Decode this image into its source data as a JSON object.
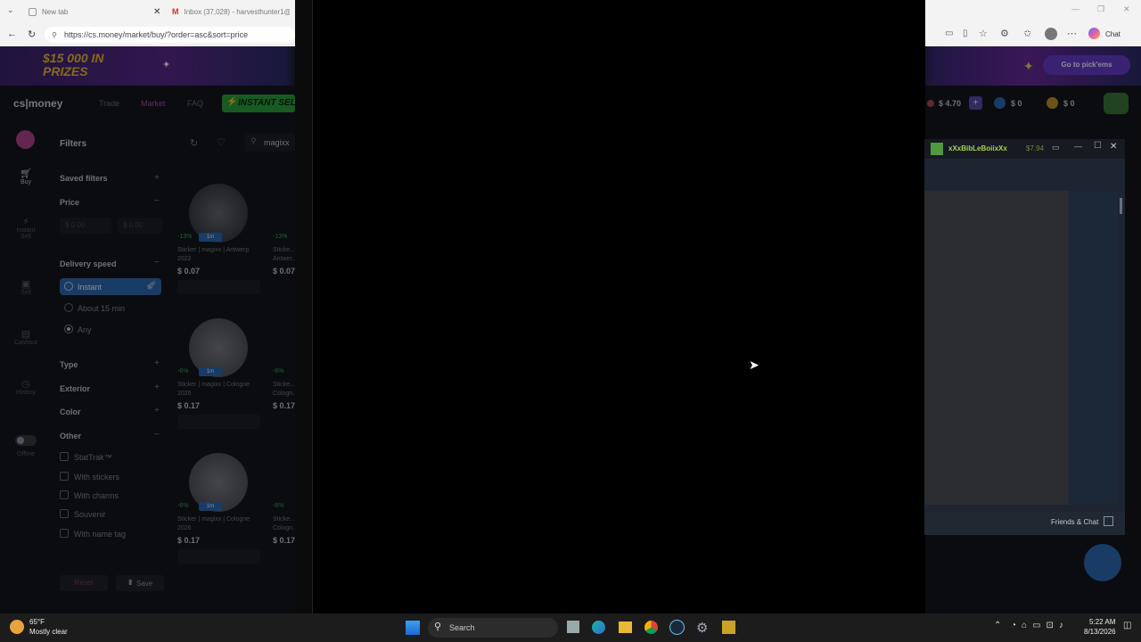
{
  "browser": {
    "tabs": [
      {
        "label": "New tab"
      },
      {
        "label": "Inbox (37,028) - harvesthunter1@..."
      }
    ],
    "url": "https://cs.money/market/buy/?order=asc&sort=price",
    "chat_label": "Chat"
  },
  "site": {
    "logo": "cs|money",
    "promo": "$15 000 IN PRIZES",
    "promo_cta": "Go to pick'ems",
    "nav": [
      "Trade",
      "Market",
      "FAQ"
    ],
    "instant_sell": "INSTANT SELL",
    "balances": [
      "$ 4.70",
      "$ 0",
      "$ 0"
    ]
  },
  "sidebar_nav": [
    {
      "label": "Buy"
    },
    {
      "label": "Instant Sell"
    },
    {
      "label": "Sell"
    },
    {
      "label": "Cashout"
    },
    {
      "label": "History"
    },
    {
      "label": "Offline"
    }
  ],
  "filters": {
    "title": "Filters",
    "saved": "Saved filters",
    "price": "Price",
    "price_min_placeholder": "$ 0.00",
    "price_max_placeholder": "$ 0.00",
    "delivery": "Delivery speed",
    "delivery_options": [
      "Instant",
      "About 15 min",
      "Any"
    ],
    "type": "Type",
    "exterior": "Exterior",
    "color": "Color",
    "other": "Other",
    "other_options": [
      "StatTrak™",
      "With stickers",
      "With charms",
      "Souvenir",
      "With name tag"
    ],
    "reset": "Reset",
    "save": "Save",
    "search_value": "magixx"
  },
  "items": [
    {
      "name": "Sticker | magixx | Antwerp 2022",
      "price": "$ 0.07",
      "discount": "-13%",
      "badge": "1m"
    },
    {
      "name": "Sticker | magixx | Cologne 2026",
      "price": "$ 0.17",
      "discount": "-6%",
      "badge": "1m"
    },
    {
      "name": "Sticker | magixx | Cologne 2026",
      "price": "$ 0.17",
      "discount": "-6%",
      "badge": "1m"
    }
  ],
  "items_col2": [
    {
      "name": "Sticke... Antwer...",
      "price": "$ 0.07",
      "discount": "-13%"
    },
    {
      "name": "Sticke... Cologn...",
      "price": "$ 0.17",
      "discount": "-6%"
    },
    {
      "name": "Sticke... Cologn...",
      "price": "$ 0.17",
      "discount": "-6%"
    }
  ],
  "steam": {
    "user": "xXxBibLeBoiixXx",
    "balance": "$7.94",
    "friends_chat": "Friends & Chat"
  },
  "taskbar": {
    "weather_temp": "65°F",
    "weather_desc": "Mostly clear",
    "search": "Search",
    "time": "5:22 AM",
    "date": "8/13/2026"
  }
}
